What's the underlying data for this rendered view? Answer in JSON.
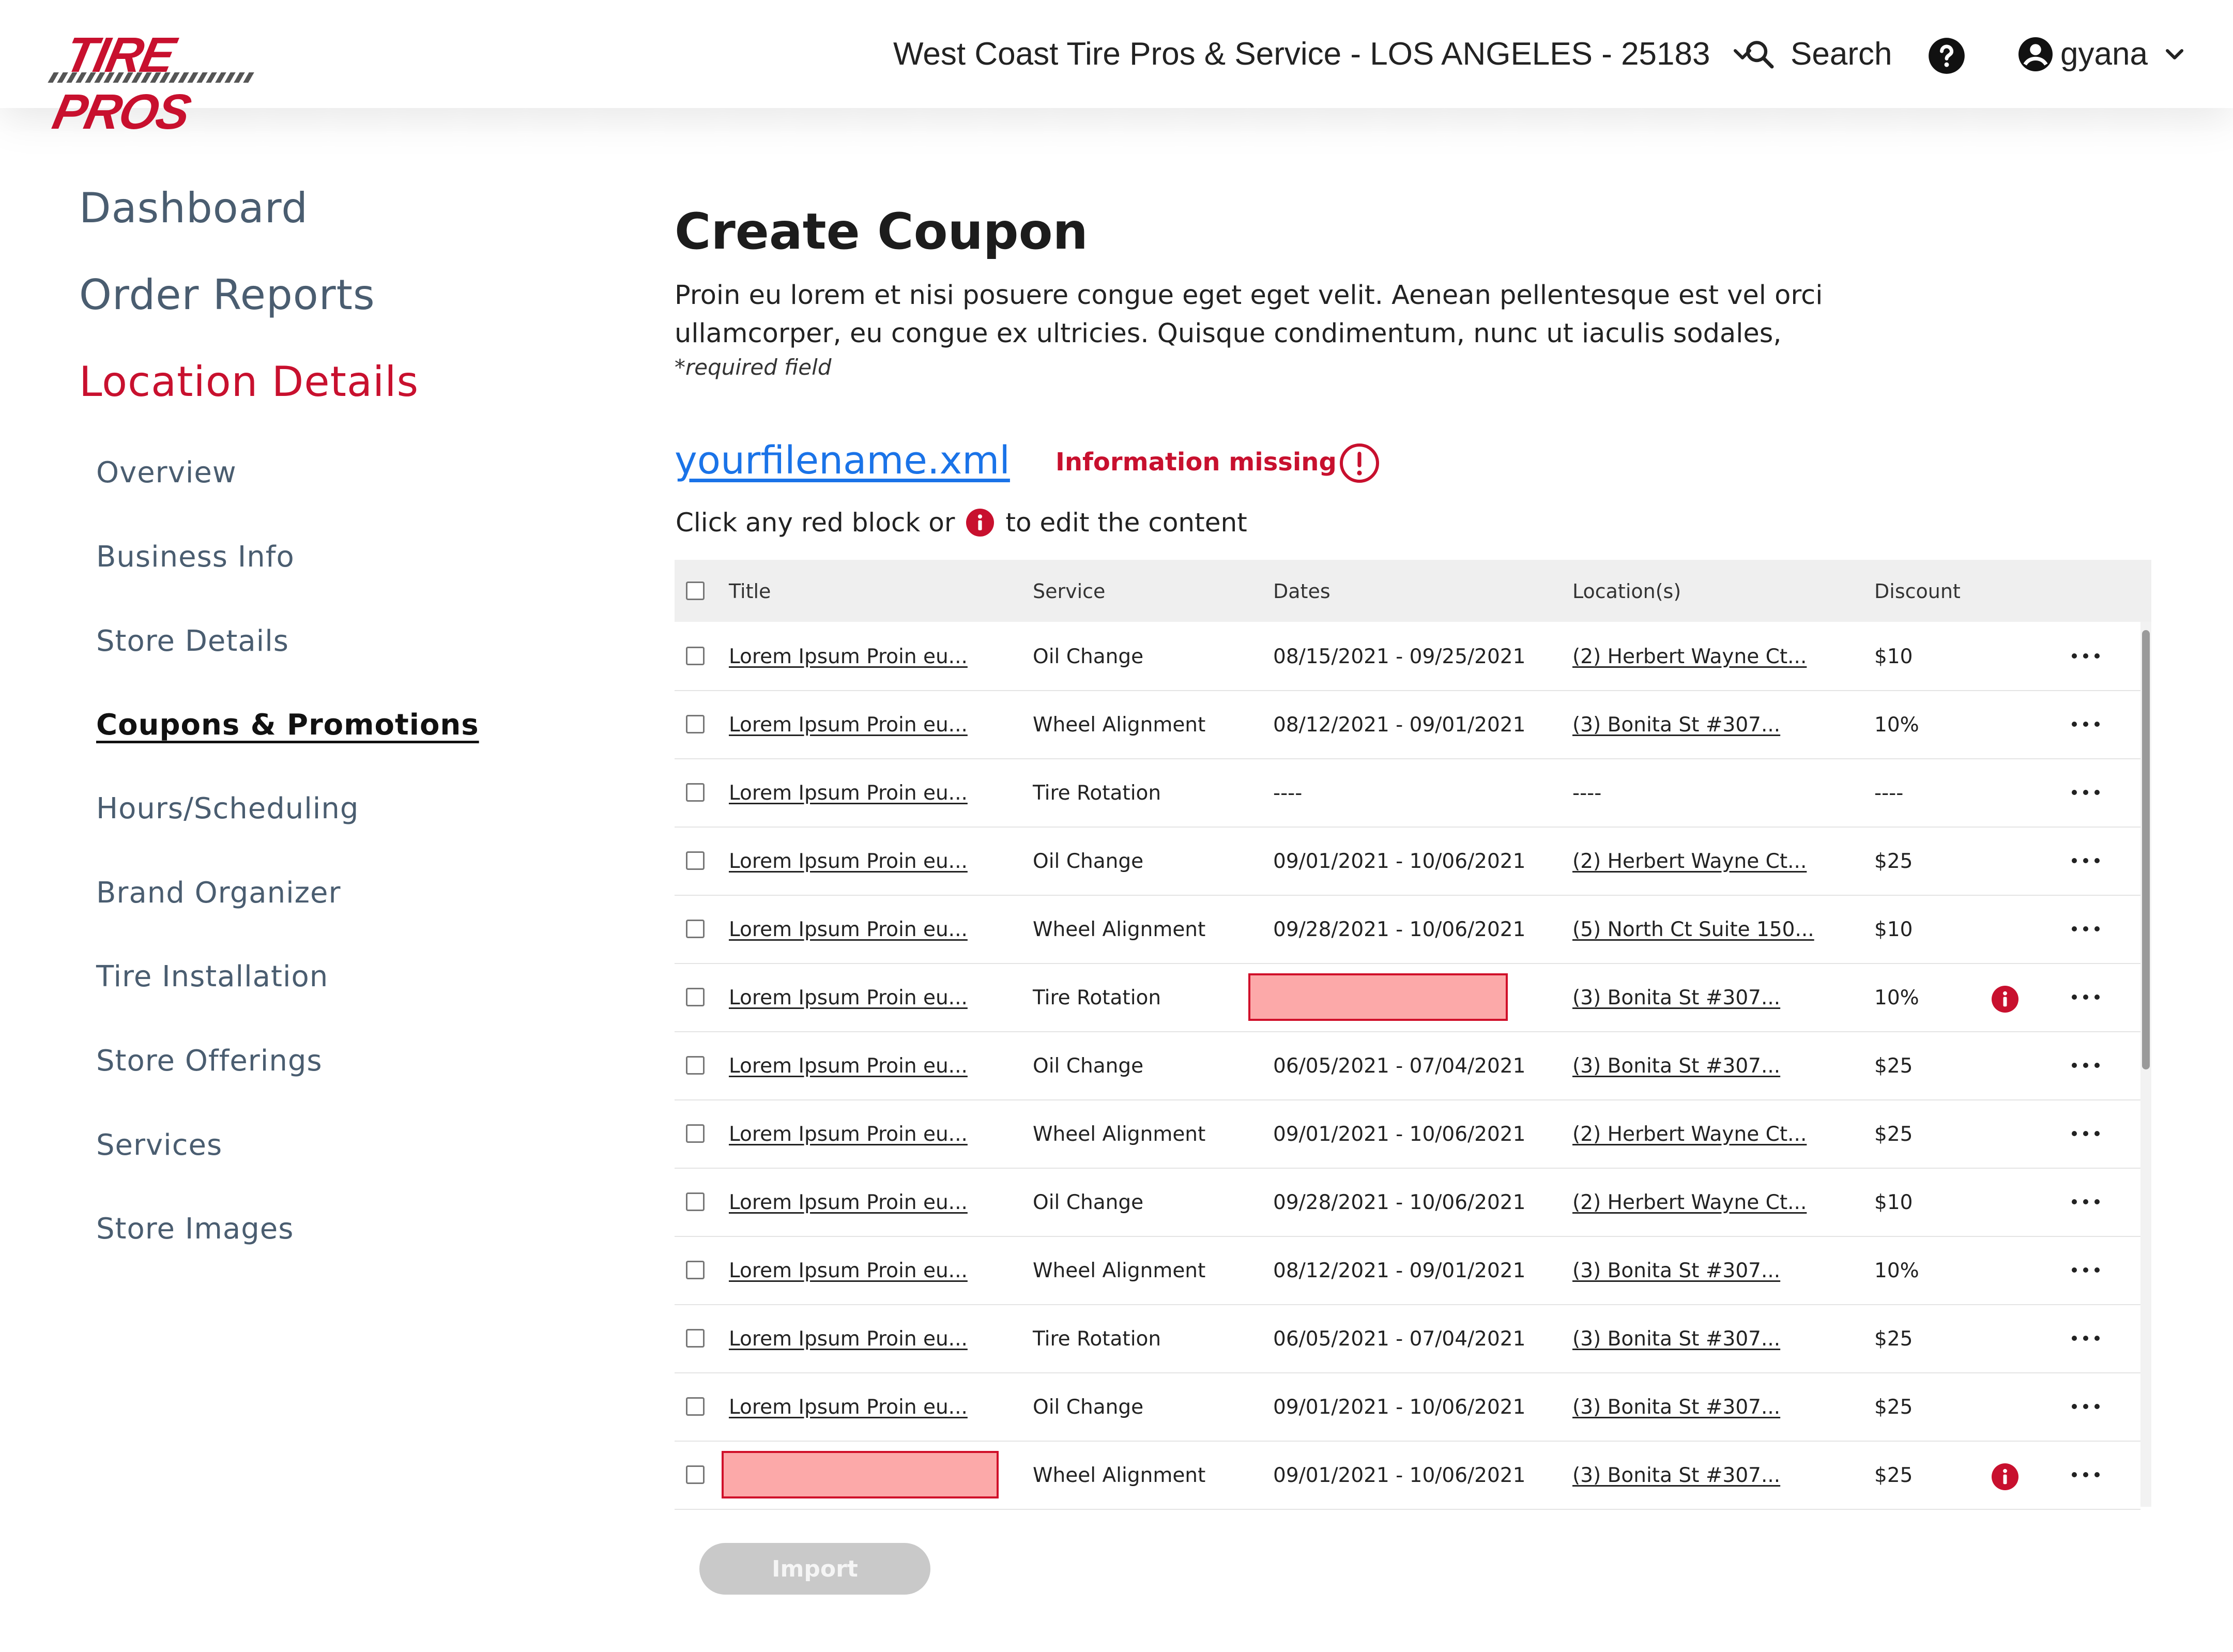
{
  "header": {
    "brand": "TIRE PROS",
    "location": "West Coast Tire Pros & Service - LOS ANGELES - 25183",
    "search_label": "Search",
    "username": "gyana"
  },
  "sidebar": {
    "main": [
      "Dashboard",
      "Order Reports",
      "Location Details"
    ],
    "active_main": "Location Details",
    "sub": [
      "Overview",
      "Business Info",
      "Store Details",
      "Coupons & Promotions",
      "Hours/Scheduling",
      "Brand Organizer",
      "Tire Installation",
      "Store Offerings",
      "Services",
      "Store Images"
    ],
    "current_sub": "Coupons & Promotions"
  },
  "page": {
    "title": "Create Coupon",
    "description": "Proin eu lorem et nisi posuere congue eget eget velit. Aenean pellentesque est vel orci ullamcorper, eu congue ex ultricies. Quisque condimentum, nunc ut iaculis sodales,",
    "required_note": "*required field",
    "filename": "yourfilename.xml",
    "missing_label": "Information missing",
    "hint_before": "Click any red block or",
    "hint_after": "to edit the content",
    "import_label": "Import"
  },
  "table": {
    "columns": [
      "Title",
      "Service",
      "Dates",
      "Location(s)",
      "Discount"
    ],
    "rows": [
      {
        "title": "Lorem Ipsum Proin eu...",
        "service": "Oil Change",
        "dates": "08/15/2021 - 09/25/2021",
        "location": "(2) Herbert Wayne Ct...",
        "discount": "$10"
      },
      {
        "title": "Lorem Ipsum Proin eu...",
        "service": "Wheel Alignment",
        "dates": "08/12/2021 - 09/01/2021",
        "location": "(3) Bonita St #307...",
        "discount": "10%"
      },
      {
        "title": "Lorem Ipsum Proin eu...",
        "service": "Tire Rotation",
        "dates": "----",
        "location": "----",
        "discount": "----"
      },
      {
        "title": "Lorem Ipsum Proin eu...",
        "service": "Oil Change",
        "dates": "09/01/2021 - 10/06/2021",
        "location": "(2) Herbert Wayne Ct...",
        "discount": "$25"
      },
      {
        "title": "Lorem Ipsum Proin eu...",
        "service": "Wheel Alignment",
        "dates": "09/28/2021 - 10/06/2021",
        "location": "(5) North Ct Suite 150...",
        "discount": "$10"
      },
      {
        "title": "Lorem Ipsum Proin eu...",
        "service": "Tire Rotation",
        "dates": "",
        "location": "(3) Bonita St #307...",
        "discount": "10%",
        "missing": "dates"
      },
      {
        "title": "Lorem Ipsum Proin eu...",
        "service": "Oil Change",
        "dates": "06/05/2021 - 07/04/2021",
        "location": "(3) Bonita St #307...",
        "discount": "$25"
      },
      {
        "title": "Lorem Ipsum Proin eu...",
        "service": "Wheel Alignment",
        "dates": "09/01/2021 - 10/06/2021",
        "location": "(2) Herbert Wayne Ct...",
        "discount": "$25"
      },
      {
        "title": "Lorem Ipsum Proin eu...",
        "service": "Oil Change",
        "dates": "09/28/2021 - 10/06/2021",
        "location": "(2) Herbert Wayne Ct...",
        "discount": "$10"
      },
      {
        "title": "Lorem Ipsum Proin eu...",
        "service": "Wheel Alignment",
        "dates": "08/12/2021 - 09/01/2021",
        "location": "(3) Bonita St #307...",
        "discount": "10%"
      },
      {
        "title": "Lorem Ipsum Proin eu...",
        "service": "Tire Rotation",
        "dates": "06/05/2021 - 07/04/2021",
        "location": "(3) Bonita St #307...",
        "discount": "$25"
      },
      {
        "title": "Lorem Ipsum Proin eu...",
        "service": "Oil Change",
        "dates": "09/01/2021 - 10/06/2021",
        "location": "(3) Bonita St #307...",
        "discount": "$25"
      },
      {
        "title": "",
        "service": "Wheel Alignment",
        "dates": "09/01/2021 - 10/06/2021",
        "location": "(3) Bonita St #307...",
        "discount": "$25",
        "missing": "title"
      }
    ]
  },
  "colors": {
    "brand_red": "#c8102e",
    "link_blue": "#1a73e8",
    "missing_fill": "#fca9a9",
    "sidebar_text": "#4a5d70",
    "button_disabled": "#c9c9c9"
  },
  "icons": [
    "chevron-down-icon",
    "search-icon",
    "help-icon",
    "account-icon",
    "exclamation-circle-icon",
    "info-icon",
    "more-horizontal-icon"
  ]
}
